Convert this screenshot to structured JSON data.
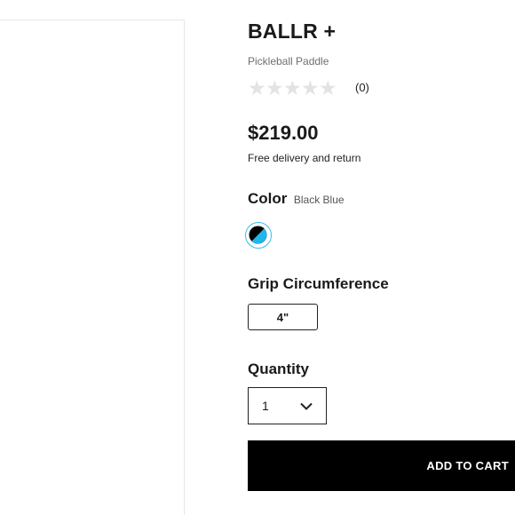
{
  "product": {
    "title": "BALLR +",
    "subtitle": "Pickleball Paddle",
    "rating": 0,
    "rating_max": 5,
    "review_count": "(0)",
    "price": "$219.00",
    "delivery_note": "Free delivery and return"
  },
  "color": {
    "label": "Color",
    "selected_value": "Black Blue",
    "swatch_colors": [
      "#000000",
      "#1fb8ee"
    ],
    "selected_ring_color": "#39bdec"
  },
  "grip": {
    "label": "Grip Circumference",
    "options": [
      "4\""
    ]
  },
  "quantity": {
    "label": "Quantity",
    "value": "1"
  },
  "cart": {
    "button_label": "ADD TO CART"
  },
  "icons": {
    "star": "star-icon",
    "chevron": "chevron-down-icon"
  }
}
